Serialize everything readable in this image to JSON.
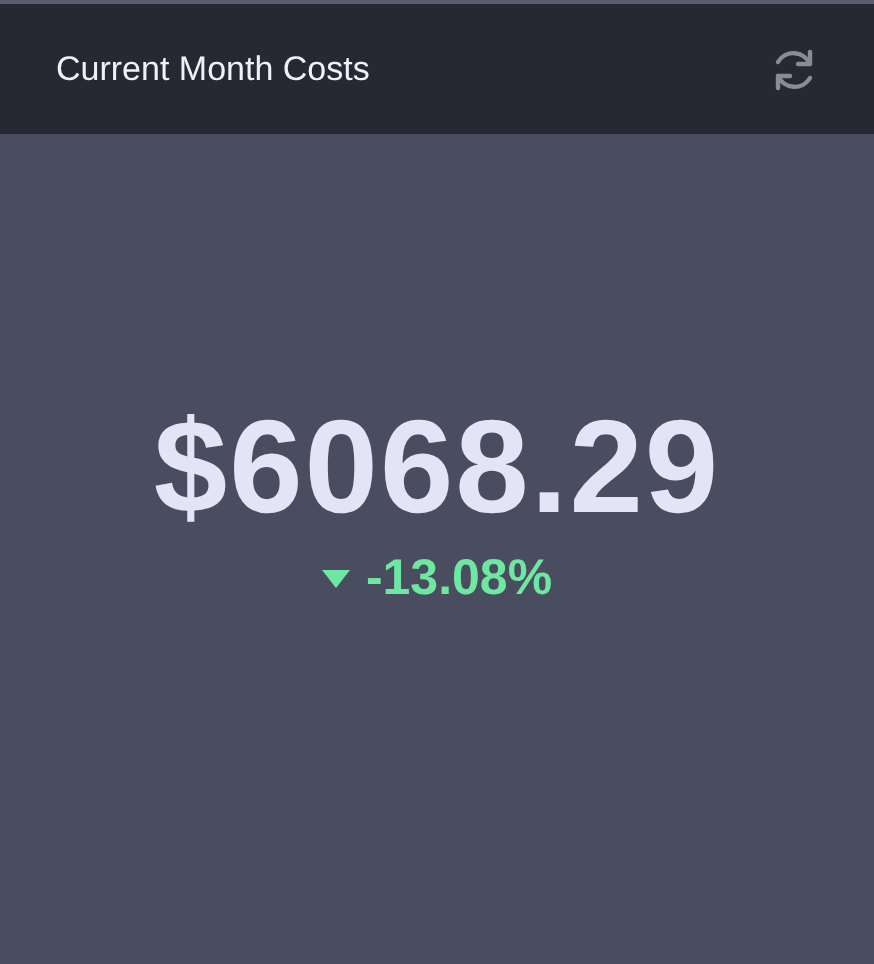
{
  "card": {
    "title": "Current Month Costs",
    "value": "$6068.29",
    "change": {
      "text": "-13.08%",
      "down": true
    }
  }
}
